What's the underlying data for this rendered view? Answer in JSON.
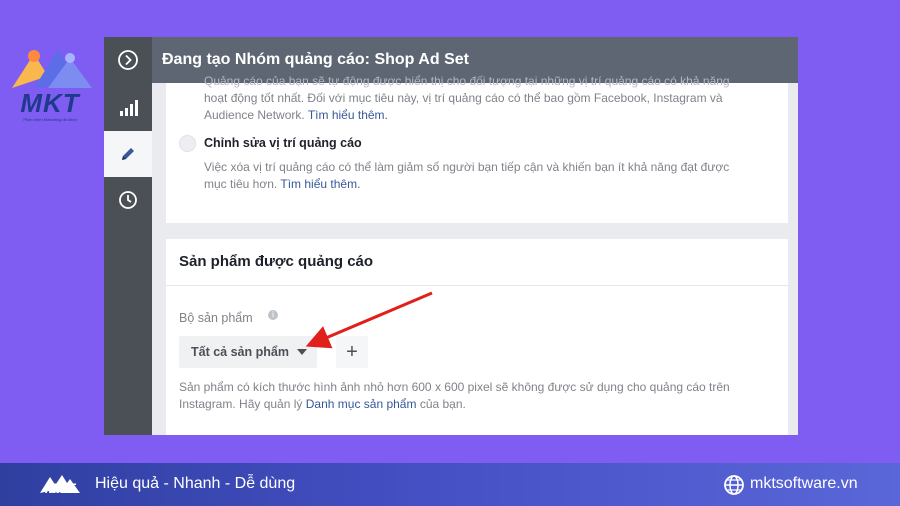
{
  "brand": {
    "logo_text": "MKT",
    "logo_tagline": "Phần mềm Marketing đa kênh"
  },
  "header": {
    "title": "Đang tạo Nhóm quảng cáo: Shop Ad Set"
  },
  "sidebar": {
    "items": [
      {
        "icon": "chevron-right-circle-icon"
      },
      {
        "icon": "bar-chart-icon"
      },
      {
        "icon": "pencil-icon"
      },
      {
        "icon": "clock-icon"
      }
    ]
  },
  "placements": {
    "auto_desc_line1_partial": "Quảng cáo của bạn sẽ tự động được hiển thị cho đối tượng tại những vị trí quảng cáo có khả năng",
    "auto_desc_line2": "hoạt động tốt nhất. Đối với mục tiêu này, vị trí quảng cáo có thể bao gồm Facebook, Instagram và",
    "auto_desc_line3": "Audience Network.",
    "auto_learn_more": "Tìm hiểu thêm.",
    "edit_label": "Chỉnh sửa vị trí quảng cáo",
    "edit_desc_line1": "Việc xóa vị trí quảng cáo có thể làm giảm số người bạn tiếp cận và khiến bạn ít khả năng đạt được",
    "edit_desc_line2": "mục tiêu hơn.",
    "edit_learn_more": "Tìm hiểu thêm."
  },
  "products": {
    "section_title": "Sản phẩm được quảng cáo",
    "field_label": "Bộ sản phẩm",
    "info_symbol": "i",
    "selected_value": "Tất cả sản phẩm",
    "add_label": "+",
    "note_line1": "Sản phẩm có kích thước hình ảnh nhỏ hơn 600 x 600 pixel sẽ không được sử dụng cho quảng cáo trên",
    "note_line2_prefix": "Instagram. Hãy quản lý",
    "note_link": "Danh mục sản phẩm",
    "note_line2_suffix": "của bạn."
  },
  "annotation": {
    "arrow_color": "#e0201b"
  },
  "footer": {
    "logo_text": "MKT",
    "slogan": "Hiệu quả - Nhanh - Dễ dùng",
    "website": "mktsoftware.vn"
  },
  "colors": {
    "background": "#7f5cf2",
    "sidebar": "#4b4f56",
    "topbar": "#5f6673",
    "link": "#365899",
    "footer": "#3f4bb8"
  }
}
